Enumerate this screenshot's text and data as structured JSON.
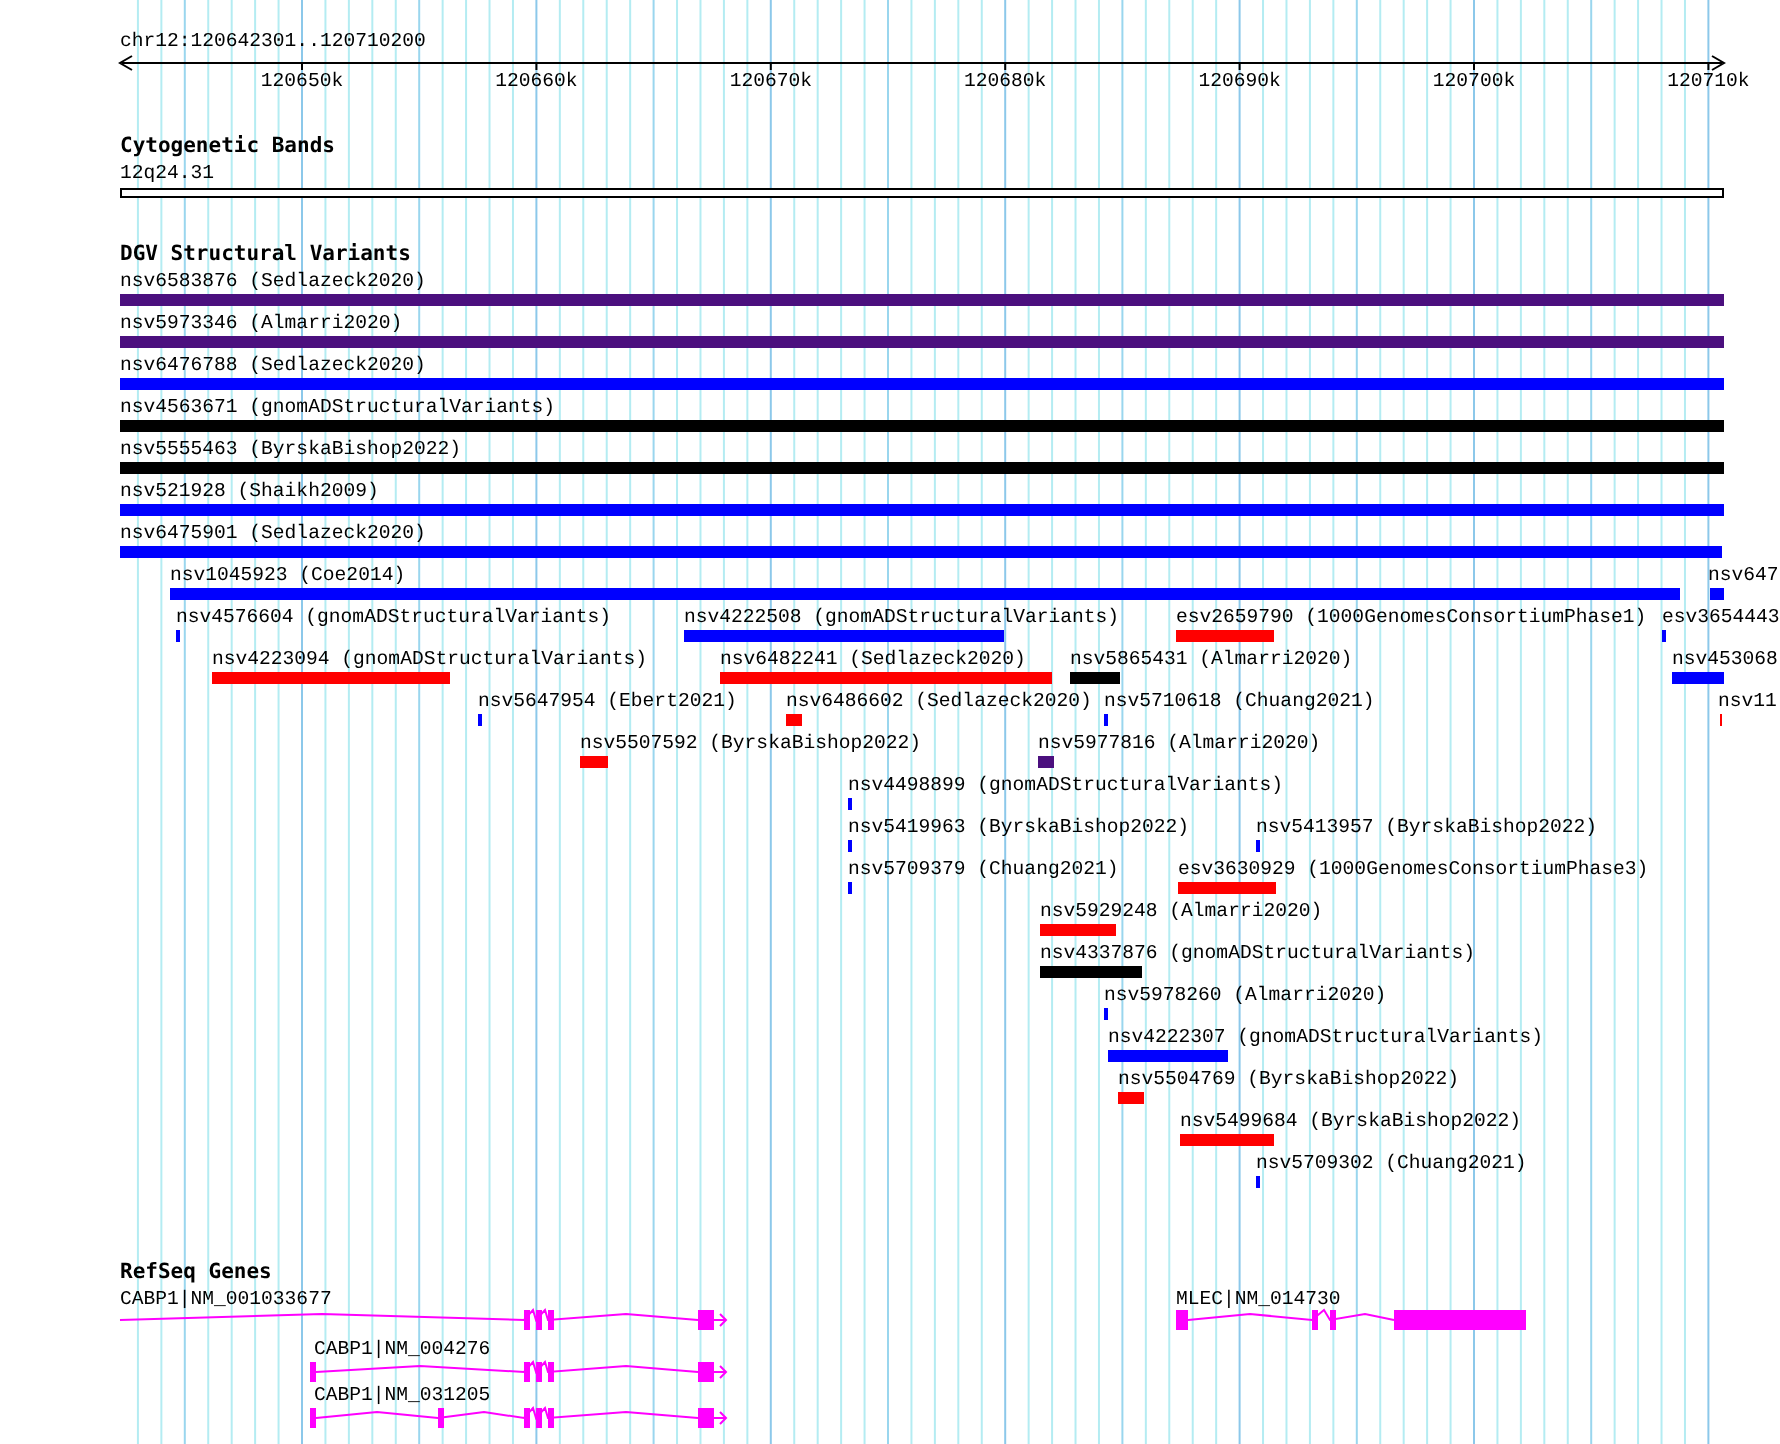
{
  "ruler": {
    "location": "chr12:120642301..120710200",
    "ticks": [
      "120650k",
      "120660k",
      "120670k",
      "120680k",
      "120690k",
      "120700k",
      "120710k"
    ]
  },
  "cytogenetic_bands": {
    "title": "Cytogenetic Bands",
    "band": "12q24.31"
  },
  "dgv": {
    "title": "DGV Structural Variants",
    "variants": [
      {
        "label": "nsv6583876 (Sedlazeck2020)",
        "color": "#4b0f7e"
      },
      {
        "label": "nsv5973346 (Almarri2020)",
        "color": "#4b0f7e"
      },
      {
        "label": "nsv6476788 (Sedlazeck2020)",
        "color": "#0000ff"
      },
      {
        "label": "nsv4563671 (gnomADStructuralVariants)",
        "color": "#000000"
      },
      {
        "label": "nsv5555463 (ByrskaBishop2022)",
        "color": "#000000"
      },
      {
        "label": "nsv521928 (Shaikh2009)",
        "color": "#0000ff"
      },
      {
        "label": "nsv6475901 (Sedlazeck2020)",
        "color": "#0000ff"
      },
      {
        "label": "nsv1045923 (Coe2014)",
        "color": "#0000ff"
      },
      {
        "label": "nsv647",
        "color": "#0000ff"
      },
      {
        "label": "nsv4576604 (gnomADStructuralVariants)",
        "color": "#0000ff"
      },
      {
        "label": "nsv4222508 (gnomADStructuralVariants)",
        "color": "#0000ff"
      },
      {
        "label": "esv2659790 (1000GenomesConsortiumPhase1)",
        "color": "#ff0000"
      },
      {
        "label": "esv3654443",
        "color": "#0000ff"
      },
      {
        "label": "nsv4223094 (gnomADStructuralVariants)",
        "color": "#ff0000"
      },
      {
        "label": "nsv6482241 (Sedlazeck2020)",
        "color": "#ff0000"
      },
      {
        "label": "nsv5865431 (Almarri2020)",
        "color": "#000000"
      },
      {
        "label": "nsv453068",
        "color": "#0000ff"
      },
      {
        "label": "nsv5647954 (Ebert2021)",
        "color": "#0000ff"
      },
      {
        "label": "nsv6486602 (Sedlazeck2020)",
        "color": "#ff0000"
      },
      {
        "label": "nsv5710618 (Chuang2021)",
        "color": "#0000ff"
      },
      {
        "label": "nsv11",
        "color": "#ff0000"
      },
      {
        "label": "nsv5507592 (ByrskaBishop2022)",
        "color": "#ff0000"
      },
      {
        "label": "nsv5977816 (Almarri2020)",
        "color": "#4b0f7e"
      },
      {
        "label": "nsv4498899 (gnomADStructuralVariants)",
        "color": "#0000ff"
      },
      {
        "label": "nsv5419963 (ByrskaBishop2022)",
        "color": "#0000ff"
      },
      {
        "label": "nsv5413957 (ByrskaBishop2022)",
        "color": "#0000ff"
      },
      {
        "label": "nsv5709379 (Chuang2021)",
        "color": "#0000ff"
      },
      {
        "label": "esv3630929 (1000GenomesConsortiumPhase3)",
        "color": "#ff0000"
      },
      {
        "label": "nsv5929248 (Almarri2020)",
        "color": "#ff0000"
      },
      {
        "label": "nsv4337876 (gnomADStructuralVariants)",
        "color": "#000000"
      },
      {
        "label": "nsv5978260 (Almarri2020)",
        "color": "#0000ff"
      },
      {
        "label": "nsv4222307 (gnomADStructuralVariants)",
        "color": "#0000ff"
      },
      {
        "label": "nsv5504769 (ByrskaBishop2022)",
        "color": "#ff0000"
      },
      {
        "label": "nsv5499684 (ByrskaBishop2022)",
        "color": "#ff0000"
      },
      {
        "label": "nsv5709302 (Chuang2021)",
        "color": "#0000ff"
      }
    ]
  },
  "refseq_genes": {
    "title": "RefSeq Genes",
    "genes": [
      {
        "label": "CABP1|NM_001033677"
      },
      {
        "label": "CABP1|NM_004276"
      },
      {
        "label": "CABP1|NM_031205"
      },
      {
        "label": "MLEC|NM_014730"
      }
    ]
  }
}
